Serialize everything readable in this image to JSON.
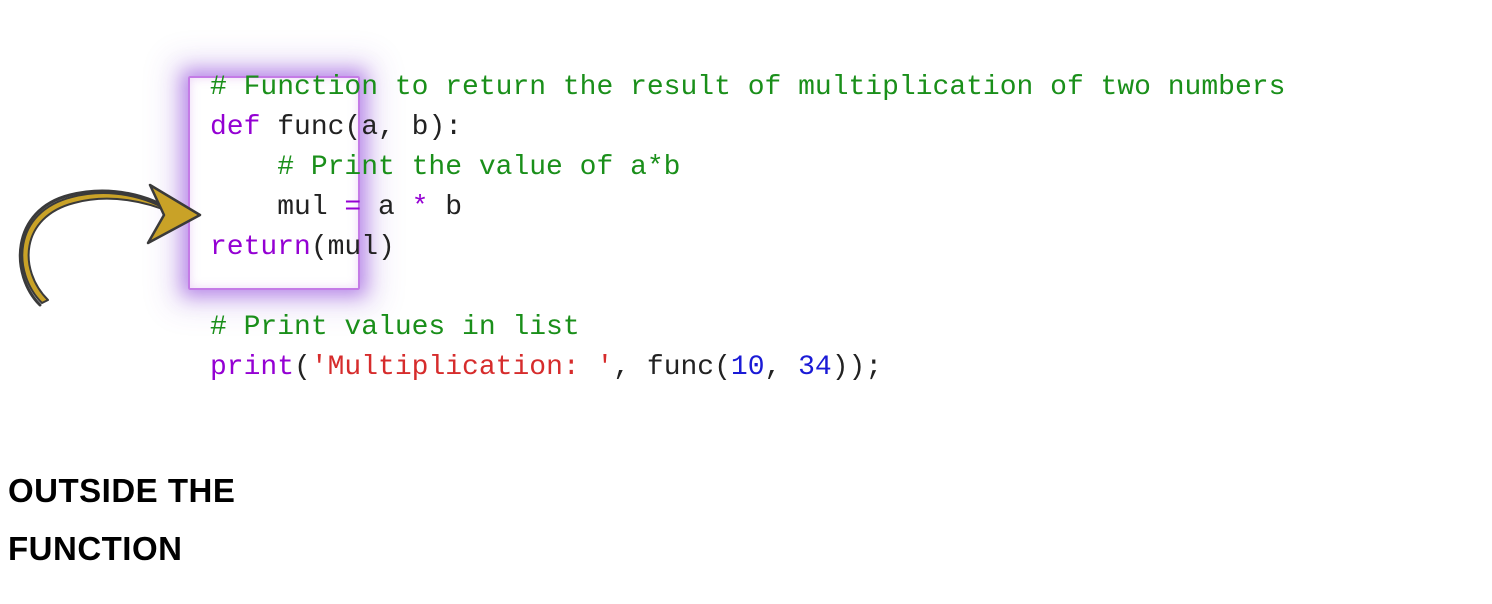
{
  "code": {
    "line1_comment": "# Function to return the result of multiplication of two numbers",
    "line2_def": "def",
    "line2_name": " func(a, b):",
    "line3_comment": "    # Print the value of a*b",
    "line4_pre": "    mul ",
    "line4_eq": "=",
    "line4_mid": " a ",
    "line4_star": "*",
    "line4_end": " b",
    "line5_return": "return",
    "line5_after": "(mul)",
    "line7_comment": "# Print values in list",
    "line8_print": "print",
    "line8_paren_open": "(",
    "line8_string": "'Multiplication: '",
    "line8_comma": ", func(",
    "line8_num1": "10",
    "line8_comma2": ", ",
    "line8_num2": "34",
    "line8_close": "));"
  },
  "caption": {
    "line1": "OUTSIDE THE",
    "line2": "FUNCTION"
  }
}
